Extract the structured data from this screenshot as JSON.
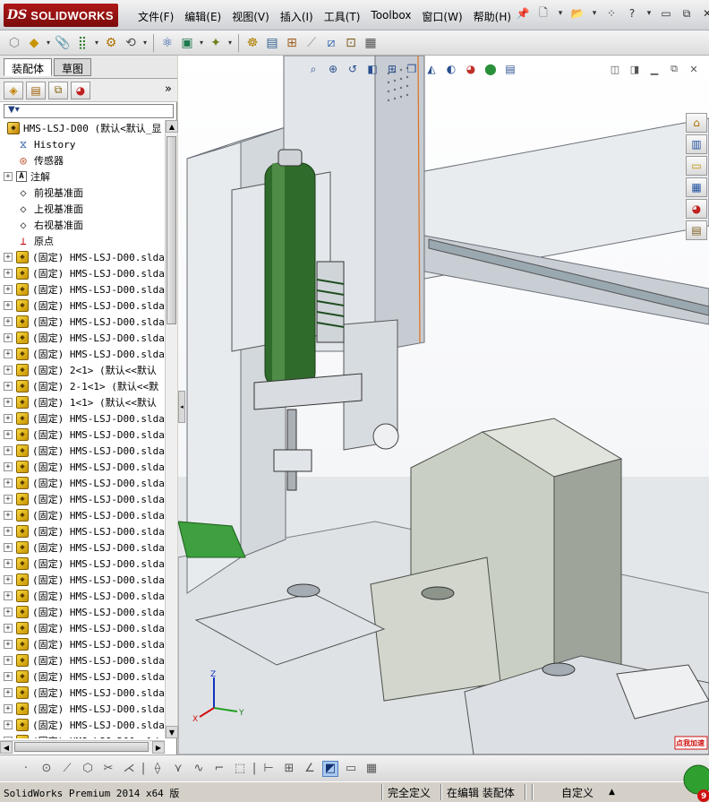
{
  "app": {
    "brand_prefix": "DS",
    "brand_name": "SOLIDWORKS",
    "menu": [
      {
        "label": "文件(F)",
        "name": "menu-file"
      },
      {
        "label": "编辑(E)",
        "name": "menu-edit"
      },
      {
        "label": "视图(V)",
        "name": "menu-view"
      },
      {
        "label": "插入(I)",
        "name": "menu-insert"
      },
      {
        "label": "工具(T)",
        "name": "menu-tools"
      },
      {
        "label": "Toolbox",
        "name": "menu-toolbox"
      },
      {
        "label": "窗口(W)",
        "name": "menu-window"
      },
      {
        "label": "帮助(H)",
        "name": "menu-help"
      }
    ],
    "title_icons": [
      "pin-icon",
      "new-document-icon",
      "open-icon",
      "rebuild-icon",
      "help-icon",
      "minimize-icon",
      "restore-icon",
      "close-icon"
    ]
  },
  "command_bar": {
    "icons": [
      "assembly-icon",
      "insert-component-icon",
      "mate-icon",
      "linear-pattern-icon",
      "smart-fasteners-icon",
      "move-component-icon",
      "show-hidden-icon",
      "assembly-features-icon",
      "reference-geometry-icon",
      "new-motion-study-icon",
      "bill-of-materials-icon",
      "exploded-view-icon",
      "explode-line-icon",
      "interference-icon",
      "instant3d-icon"
    ]
  },
  "left_panel": {
    "tabs": [
      {
        "label": "装配体",
        "active": true
      },
      {
        "label": "草图",
        "active": false
      }
    ],
    "manager_icons": [
      "featuremanager-icon",
      "propertymanager-icon",
      "configurationmanager-icon",
      "displaymanager-icon"
    ],
    "more": "»",
    "filter_icon": "filter-icon",
    "tree": {
      "root": "HMS-LSJ-D00  (默认<默认_显",
      "items": [
        {
          "label": "History",
          "icon": "history-icon",
          "expandable": false
        },
        {
          "label": "传感器",
          "icon": "sensor-icon",
          "expandable": false
        },
        {
          "label": "注解",
          "icon": "annotation-icon",
          "expandable": true
        },
        {
          "label": "前视基准面",
          "icon": "plane-icon",
          "expandable": false
        },
        {
          "label": "上视基准面",
          "icon": "plane-icon",
          "expandable": false
        },
        {
          "label": "右视基准面",
          "icon": "plane-icon",
          "expandable": false
        },
        {
          "label": "原点",
          "icon": "origin-icon",
          "expandable": false
        }
      ],
      "components": [
        "(固定) HMS-LSJ-D00.slda",
        "(固定) HMS-LSJ-D00.slda",
        "(固定) HMS-LSJ-D00.slda",
        "(固定) HMS-LSJ-D00.slda",
        "(固定) HMS-LSJ-D00.slda",
        "(固定) HMS-LSJ-D00.slda",
        "(固定) HMS-LSJ-D00.slda",
        "(固定) 2<1> (默认<<默认",
        "(固定) 2-1<1> (默认<<默",
        "(固定) 1<1> (默认<<默认",
        "(固定) HMS-LSJ-D00.slda",
        "(固定) HMS-LSJ-D00.slda",
        "(固定) HMS-LSJ-D00.slda",
        "(固定) HMS-LSJ-D00.slda",
        "(固定) HMS-LSJ-D00.slda",
        "(固定) HMS-LSJ-D00.slda",
        "(固定) HMS-LSJ-D00.slda",
        "(固定) HMS-LSJ-D00.slda",
        "(固定) HMS-LSJ-D00.slda",
        "(固定) HMS-LSJ-D00.slda",
        "(固定) HMS-LSJ-D00.slda",
        "(固定) HMS-LSJ-D00.slda",
        "(固定) HMS-LSJ-D00.slda",
        "(固定) HMS-LSJ-D00.slda",
        "(固定) HMS-LSJ-D00.slda",
        "(固定) HMS-LSJ-D00.slda",
        "(固定) HMS-LSJ-D00.slda",
        "(固定) HMS-LSJ-D00.slda",
        "(固定) HMS-LSJ-D00.slda",
        "(固定) HMS-LSJ-D00.slda",
        "(固定) HMS-LSJ-D00.slda"
      ]
    }
  },
  "viewport": {
    "heads_up_icons": [
      "zoom-to-fit-icon",
      "zoom-area-icon",
      "previous-view-icon",
      "section-view-icon",
      "dynamic-annotation-icon",
      "view-orientation-icon",
      "display-style-icon",
      "hide-show-icon",
      "edit-appearance-icon",
      "apply-scene-icon",
      "view-settings-icon"
    ],
    "window_icons": [
      "tile-left-icon",
      "tile-right-icon",
      "minimize-icon",
      "restore-icon",
      "close-icon"
    ],
    "task_pane_icons": [
      "home-icon",
      "design-library-icon",
      "file-explorer-icon",
      "view-palette-icon",
      "appearances-icon",
      "custom-properties-icon"
    ],
    "triad": {
      "x": "X",
      "y": "Y",
      "z": "Z"
    }
  },
  "draw_toolbar": {
    "icons": [
      "point-icon",
      "circle-icon",
      "line-icon",
      "polygon-icon",
      "trim-icon",
      "offset-icon",
      "mirror-icon",
      "fillet-icon",
      "spline-icon",
      "centerline-icon",
      "rectangle-icon",
      "grid-icon",
      "angle-icon",
      "display-shaded-icon",
      "split-view-icon",
      "four-view-icon"
    ]
  },
  "status": {
    "app": "SolidWorks Premium 2014 x64 版",
    "definition": "完全定义",
    "editing": "在编辑 装配体",
    "custom": "自定义",
    "arrow": "▲"
  },
  "promo": {
    "label": "点我加速",
    "badge": "9"
  },
  "colors": {
    "brand_red": "#9a1010",
    "active_tab": "#ffffff",
    "green_motor": "#2f6b2a",
    "guard_cover": "#c9cfc3",
    "frame": "#e6e9ec"
  }
}
